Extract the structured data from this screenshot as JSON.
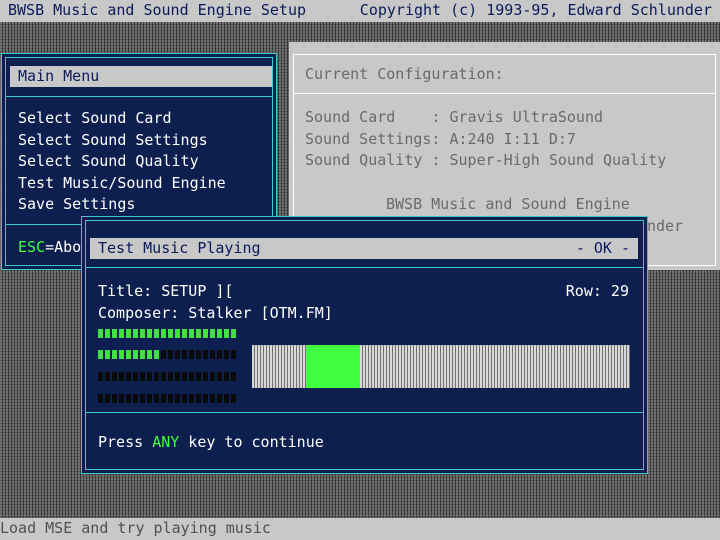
{
  "topbar": {
    "title": "BWSB Music and Sound Engine Setup",
    "copyright": "Copyright (c) 1993-95, Edward Schlunder"
  },
  "main_menu": {
    "title": "Main Menu",
    "items": [
      {
        "label": "Select Sound Card"
      },
      {
        "label": "Select Sound Settings"
      },
      {
        "label": "Select Sound Quality"
      },
      {
        "label": "Test Music/Sound Engine"
      },
      {
        "label": "Save Settings"
      }
    ],
    "esc_key": "ESC",
    "esc_text": "=Abo"
  },
  "config": {
    "title": "Current Configuration:",
    "sound_card": "Sound Card    : Gravis UltraSound",
    "sound_settings": "Sound Settings: A:240 I:11 D:7",
    "sound_quality": "Sound Quality : Super-High Sound Quality",
    "engine_name": "BWSB Music and Sound Engine",
    "author_fragment": "nder"
  },
  "dialog": {
    "title": "Test Music Playing",
    "ok": "- OK -",
    "song_title": "Title: SETUP ][",
    "row": "Row: 29",
    "composer": "Composer: Stalker [OTM.FM]",
    "footer_prefix": "Press ",
    "footer_key": "ANY",
    "footer_suffix": " key to continue"
  },
  "vu_meters": {
    "segments_per_channel": 20,
    "channels_lit": [
      20,
      9,
      0,
      0
    ]
  },
  "pattern_position": {
    "start_fraction": 0.143,
    "end_fraction": 0.286
  },
  "status_bar": {
    "message": "Load MSE and try playing music"
  },
  "colors": {
    "panel_blue": "#0d1f4e",
    "border_cyan": "#3ac8c8",
    "highlight_green": "#40ff40",
    "bar_gray": "#c8c8c8"
  }
}
